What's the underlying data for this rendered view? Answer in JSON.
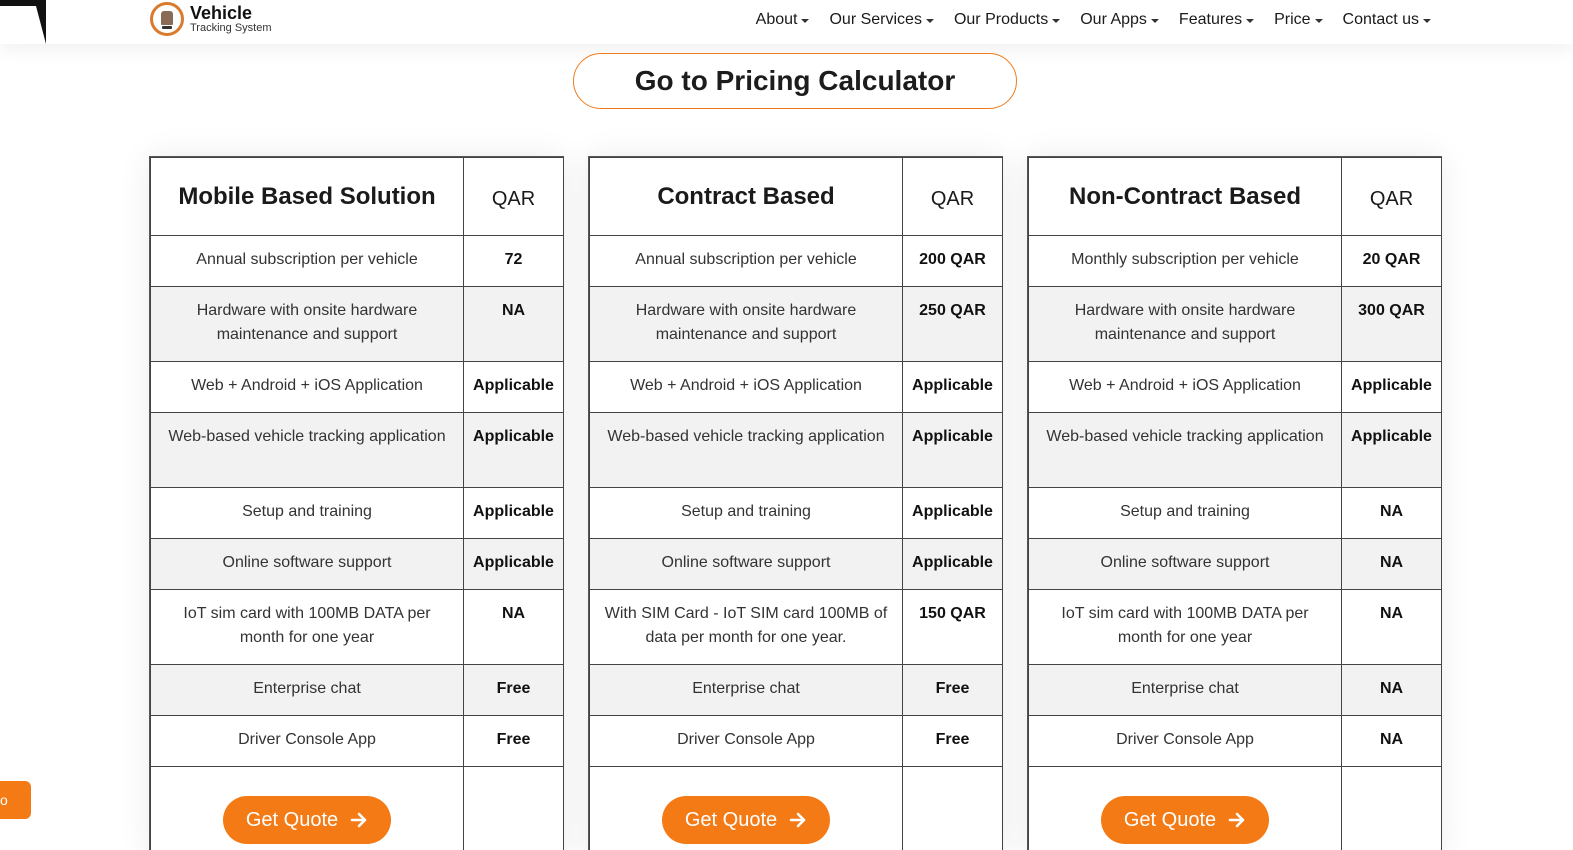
{
  "brand": {
    "title": "Vehicle",
    "subtitle": "Tracking System"
  },
  "nav": [
    {
      "label": "About"
    },
    {
      "label": "Our Services"
    },
    {
      "label": "Our Products"
    },
    {
      "label": "Our Apps"
    },
    {
      "label": "Features"
    },
    {
      "label": "Price"
    },
    {
      "label": "Contact us"
    }
  ],
  "calculator_button": "Go to Pricing Calculator",
  "side_tab": "o",
  "plans": [
    {
      "title": "Mobile Based Solution",
      "currency": "QAR",
      "rows": [
        {
          "feature": "Annual subscription per vehicle",
          "value": "72"
        },
        {
          "feature": "Hardware with onsite hardware maintenance and support",
          "value": "NA"
        },
        {
          "feature": "Web + Android + iOS Application",
          "value": "Applicable"
        },
        {
          "feature": "Web-based vehicle tracking application",
          "value": "Applicable"
        },
        {
          "feature": "Setup and training",
          "value": "Applicable"
        },
        {
          "feature": "Online software support",
          "value": "Applicable"
        },
        {
          "feature": "IoT sim card with 100MB DATA per month for one year",
          "value": "NA"
        },
        {
          "feature": "Enterprise chat",
          "value": "Free"
        },
        {
          "feature": "Driver Console App",
          "value": "Free"
        }
      ],
      "button": "Get Quote"
    },
    {
      "title": "Contract Based",
      "currency": "QAR",
      "rows": [
        {
          "feature": "Annual subscription per vehicle",
          "value": "200 QAR"
        },
        {
          "feature": "Hardware with onsite hardware maintenance and support",
          "value": "250 QAR"
        },
        {
          "feature": "Web + Android + iOS Application",
          "value": "Applicable"
        },
        {
          "feature": "Web-based vehicle tracking application",
          "value": "Applicable"
        },
        {
          "feature": "Setup and training",
          "value": "Applicable"
        },
        {
          "feature": "Online software support",
          "value": "Applicable"
        },
        {
          "feature": "With SIM Card - IoT SIM card 100MB of data per month for one year.",
          "value": "150 QAR"
        },
        {
          "feature": "Enterprise chat",
          "value": "Free"
        },
        {
          "feature": "Driver Console App",
          "value": "Free"
        }
      ],
      "button": "Get Quote"
    },
    {
      "title": "Non-Contract Based",
      "currency": "QAR",
      "rows": [
        {
          "feature": "Monthly subscription per vehicle",
          "value": "20 QAR"
        },
        {
          "feature": "Hardware with onsite hardware maintenance and support",
          "value": "300 QAR"
        },
        {
          "feature": "Web + Android + iOS Application",
          "value": "Applicable"
        },
        {
          "feature": "Web-based vehicle tracking application",
          "value": "Applicable"
        },
        {
          "feature": "Setup and training",
          "value": "NA"
        },
        {
          "feature": "Online software support",
          "value": "NA"
        },
        {
          "feature": "IoT sim card with 100MB DATA per month for one year",
          "value": "NA"
        },
        {
          "feature": "Enterprise chat",
          "value": "NA"
        },
        {
          "feature": "Driver Console App",
          "value": "NA"
        }
      ],
      "button": "Get Quote"
    }
  ],
  "colors": {
    "accent": "#f47a15",
    "row_alt": "#f2f2f2"
  },
  "icons": {
    "quote_button": "arrow-right-icon",
    "nav_dropdown": "caret-down-icon"
  }
}
